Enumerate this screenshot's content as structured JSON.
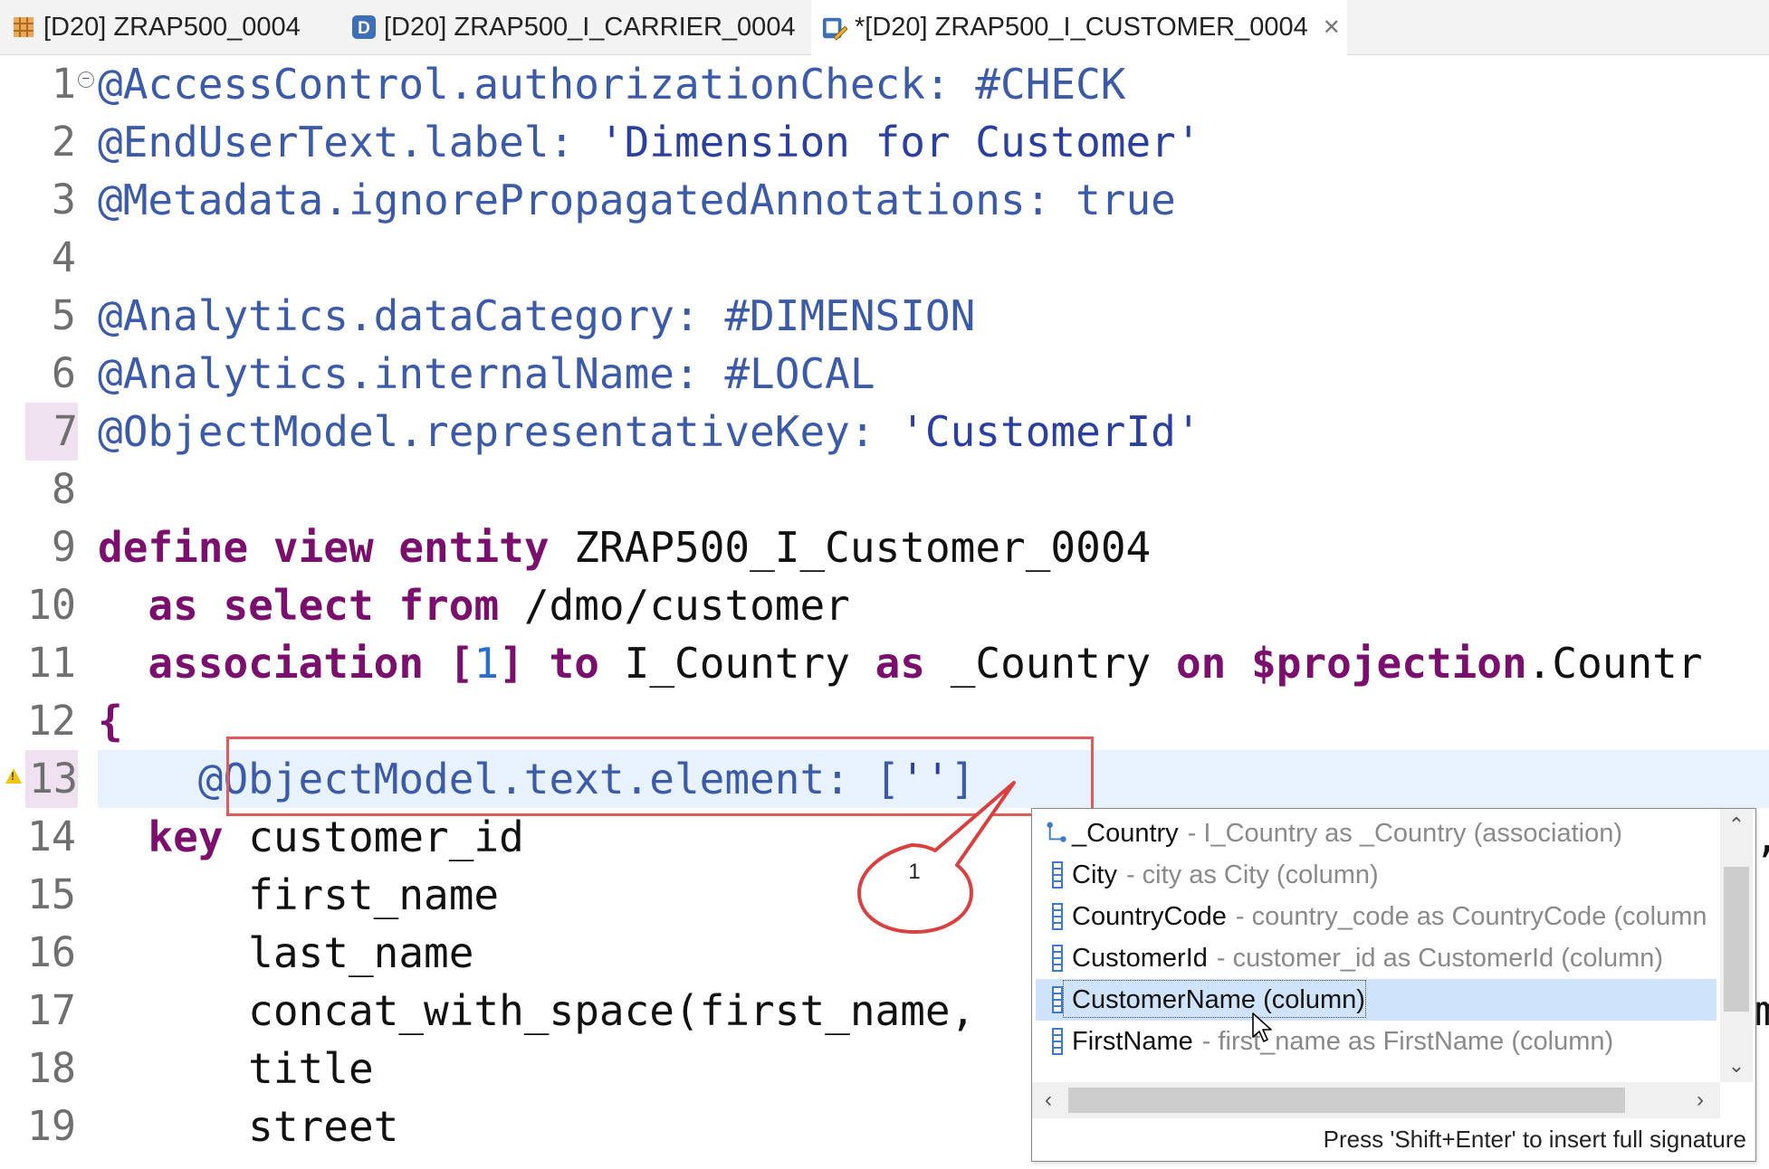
{
  "tabs": [
    {
      "label": "[D20] ZRAP500_0004",
      "icon": "package-icon",
      "active": false
    },
    {
      "label": "[D20] ZRAP500_I_CARRIER_0004",
      "icon": "ddl-d-icon",
      "active": false
    },
    {
      "label": "*[D20] ZRAP500_I_CUSTOMER_0004",
      "icon": "ddl-edit-icon",
      "active": true,
      "close": "✕"
    }
  ],
  "editor": {
    "lines": [
      {
        "n": "1"
      },
      {
        "n": "2"
      },
      {
        "n": "3"
      },
      {
        "n": "4"
      },
      {
        "n": "5"
      },
      {
        "n": "6"
      },
      {
        "n": "7"
      },
      {
        "n": "8"
      },
      {
        "n": "9"
      },
      {
        "n": "10"
      },
      {
        "n": "11"
      },
      {
        "n": "12"
      },
      {
        "n": "13"
      },
      {
        "n": "14"
      },
      {
        "n": "15"
      },
      {
        "n": "16"
      },
      {
        "n": "17"
      },
      {
        "n": "18"
      },
      {
        "n": "19"
      }
    ],
    "code": {
      "l1": {
        "a": "@AccessControl.authorizationCheck: #CHECK"
      },
      "l2": {
        "a": "@EndUserText.label: ",
        "s": "'Dimension for Customer'"
      },
      "l3": {
        "a": "@Metadata.ignorePropagatedAnnotations: true"
      },
      "l5": {
        "a": "@Analytics.dataCategory: #DIMENSION"
      },
      "l6": {
        "a": "@Analytics.internalName: #LOCAL"
      },
      "l7": {
        "a": "@ObjectModel.representativeKey: ",
        "s": "'CustomerId'"
      },
      "l9": {
        "k1": "define",
        "k2": "view",
        "k3": "entity",
        "t": "ZRAP500_I_Customer_0004"
      },
      "l10": {
        "k1": "as",
        "k2": "select",
        "k3": "from",
        "t": "/dmo/customer"
      },
      "l11": {
        "k1": "association",
        "b1": "[",
        "n": "1",
        "b2": "]",
        "k2": "to",
        "t1": "I_Country",
        "k3": "as",
        "t2": "_Country",
        "k4": "on",
        "k5": "$projection",
        "t3": ".Countr"
      },
      "l12": {
        "t": "{"
      },
      "l13": {
        "a": "@ObjectModel.text.element: [",
        "s": "''",
        "e": "]"
      },
      "l14": {
        "k": "key",
        "t": "customer_id",
        "tail": ","
      },
      "l15": {
        "t": "first_name"
      },
      "l16": {
        "t": "last_name"
      },
      "l17": {
        "t": "concat_with_space(first_name,",
        "tail": "m"
      },
      "l18": {
        "t": "title"
      },
      "l19": {
        "t": "street"
      }
    }
  },
  "callout": {
    "label": "1"
  },
  "autocomplete": {
    "items": [
      {
        "name": "_Country",
        "detail": "- I_Country as _Country (association)",
        "icon": "association-icon"
      },
      {
        "name": "City",
        "detail": "- city as City (column)",
        "icon": "column-icon"
      },
      {
        "name": "CountryCode",
        "detail": "- country_code as CountryCode (column",
        "icon": "column-icon"
      },
      {
        "name": "CustomerId",
        "detail": "- customer_id as CustomerId (column)",
        "icon": "column-icon"
      },
      {
        "name": "CustomerName (column)",
        "detail": "",
        "icon": "column-icon",
        "selected": true
      },
      {
        "name": "FirstName",
        "detail": "- first_name as FirstName (column)",
        "icon": "column-icon"
      }
    ],
    "status": "Press 'Shift+Enter' to insert full signature"
  }
}
